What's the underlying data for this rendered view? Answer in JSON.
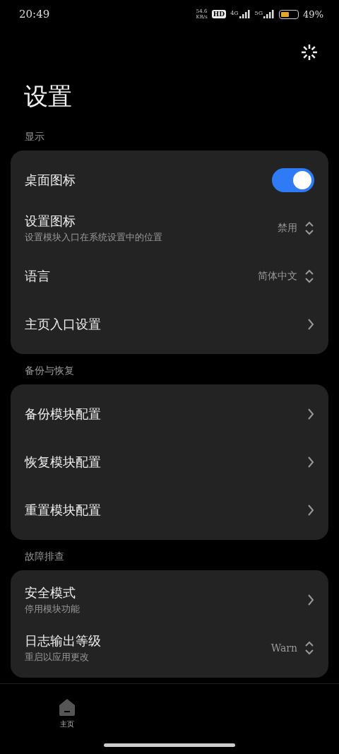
{
  "status_bar": {
    "time": "20:49",
    "net_speed": "54.6",
    "net_unit": "KB/s",
    "hd": "HD",
    "signals": [
      "4G",
      "5G"
    ],
    "battery": {
      "text": "49%"
    }
  },
  "title": "设置",
  "sections": [
    {
      "label": "显示",
      "rows": [
        {
          "kind": "toggle",
          "title": "桌面图标",
          "on": true
        },
        {
          "kind": "select",
          "title": "设置图标",
          "subtitle": "设置模块入口在系统设置中的位置",
          "value": "禁用"
        },
        {
          "kind": "select",
          "title": "语言",
          "value": "简体中文"
        },
        {
          "kind": "link",
          "title": "主页入口设置"
        }
      ]
    },
    {
      "label": "备份与恢复",
      "rows": [
        {
          "kind": "link",
          "title": "备份模块配置"
        },
        {
          "kind": "link",
          "title": "恢复模块配置"
        },
        {
          "kind": "link",
          "title": "重置模块配置"
        }
      ]
    },
    {
      "label": "故障排查",
      "rows": [
        {
          "kind": "link",
          "title": "安全模式",
          "subtitle": "停用模块功能"
        },
        {
          "kind": "select",
          "title": "日志输出等级",
          "subtitle": "重启以应用更改",
          "value": "Warn"
        }
      ]
    }
  ],
  "bottom_nav": [
    {
      "label": "主页",
      "selected": true
    }
  ]
}
